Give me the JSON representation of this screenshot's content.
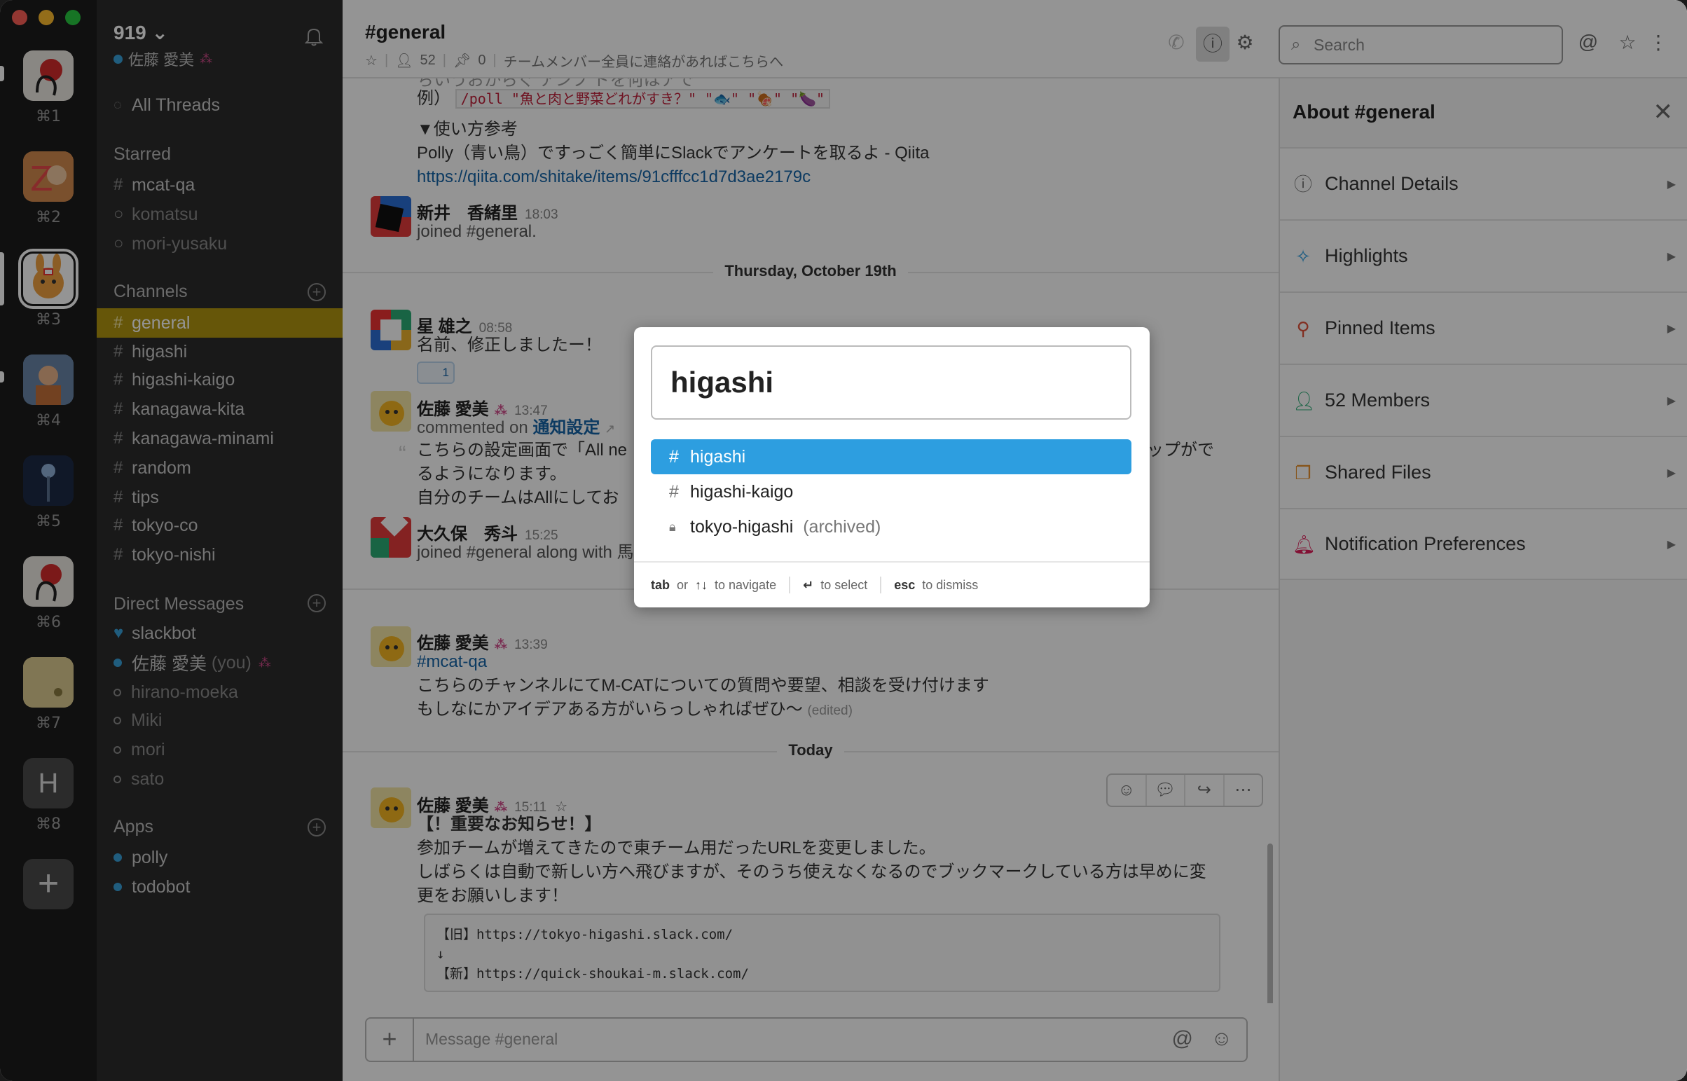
{
  "window": {
    "traffic_colors": [
      "#fe5f57",
      "#febc2e",
      "#28c840"
    ]
  },
  "teams": [
    {
      "key": "⌘1",
      "color": "#e8e4e0"
    },
    {
      "key": "⌘2",
      "color": "#d88a4a"
    },
    {
      "key": "⌘3",
      "color": "#ffffff"
    },
    {
      "key": "⌘4",
      "color": "#5a7aa0"
    },
    {
      "key": "⌘5",
      "color": "#1e2a44"
    },
    {
      "key": "⌘6",
      "color": "#e8e4e0"
    },
    {
      "key": "⌘7",
      "color": "#d8c790"
    },
    {
      "key": "⌘8",
      "letter": "H",
      "color": "#4a4a4a"
    }
  ],
  "sidebar": {
    "workspace": "919 ⌄",
    "user": "佐藤 愛美",
    "all_threads": "All Threads",
    "starred_head": "Starred",
    "starred": [
      {
        "pre": "#",
        "name": "mcat-qa"
      },
      {
        "pre": "○",
        "name": "komatsu"
      },
      {
        "pre": "○",
        "name": "mori-yusaku"
      }
    ],
    "channels_head": "Channels",
    "channels": [
      "general",
      "higashi",
      "higashi-kaigo",
      "kanagawa-kita",
      "kanagawa-minami",
      "random",
      "tips",
      "tokyo-co",
      "tokyo-nishi"
    ],
    "dm_head": "Direct Messages",
    "dms": [
      {
        "name": "slackbot",
        "status": "heart"
      },
      {
        "name": "佐藤 愛美",
        "suffix": "(you)",
        "status": "online"
      },
      {
        "name": "hirano-moeka",
        "status": "away"
      },
      {
        "name": "Miki",
        "status": "away"
      },
      {
        "name": "mori",
        "status": "away"
      },
      {
        "name": "sato",
        "status": "away"
      }
    ],
    "apps_head": "Apps",
    "apps": [
      "polly",
      "todobot"
    ]
  },
  "header": {
    "channel": "#general",
    "members": "52",
    "pins": "0",
    "topic": "チームメンバー全員に連絡があればこちらへ",
    "search_placeholder": "Search"
  },
  "messages": {
    "partial_top": "ちいうおからぐ アンプ ドを何はアで",
    "poll_prefix": "例）",
    "poll_code": "/poll \"魚と肉と野菜どれがすき？\" \"🐟\" \"🍖\" \"🍆\"",
    "howto": "▼使い方参考",
    "polly_line": "Polly（青い鳥）ですっごく簡単にSlackでアンケートを取るよ - Qiita",
    "qiita_url": "https://qiita.com/shitake/items/91cfffcc1d7d3ae2179c",
    "m1_name": "新井　香緒里",
    "m1_time": "18:03",
    "m1_text": "joined #general.",
    "day1": "Thursday, October 19th",
    "m2_name": "星 雄之",
    "m2_time": "08:58",
    "m2_text": "名前、修正しましたー！",
    "m2_reaction": "1",
    "m3_name": "佐藤 愛美",
    "m3_time": "13:47",
    "m3_commented": "commented on",
    "m3_link": "通知設定",
    "m3_quote1": "こちらの設定画面で「All ne",
    "m3_quote1_tail": "ップがで",
    "m3_quote2": "るようになります。",
    "m3_quote3": "自分のチームはAllにしてお",
    "m4_name": "大久保　秀斗",
    "m4_time": "15:25",
    "m4_text": "joined #general along with 馬",
    "m5_name": "佐藤 愛美",
    "m5_time": "13:39",
    "m5_channel": "#mcat-qa",
    "m5_line1": "こちらのチャンネルにてM-CATについての質問や要望、相談を受け付けます",
    "m5_line2": "もしなにかアイデアある方がいらっしゃればぜひ〜",
    "m5_edited": "(edited)",
    "day2": "Today",
    "m6_name": "佐藤 愛美",
    "m6_time": "15:11",
    "m6_line1": "【！重要なお知らせ！】",
    "m6_line2": "参加チームが増えてきたので東チーム用だったURLを変更しました。",
    "m6_line3": "しばらくは自動で新しい方へ飛びますが、そのうち使えなくなるのでブックマークしている方は早めに変",
    "m6_line4": "更をお願いします！",
    "pre_line1": "【旧】https://tokyo-higashi.slack.com/",
    "pre_line2": "↓",
    "pre_line3": "【新】https://quick-shoukai-m.slack.com/"
  },
  "composer": {
    "placeholder": "Message #general"
  },
  "right_panel": {
    "title": "About #general",
    "rows": [
      {
        "label": "Channel Details",
        "icon": "info-icon",
        "color": "#777"
      },
      {
        "label": "Highlights",
        "icon": "sparkle-icon",
        "color": "#2d9ee0"
      },
      {
        "label": "Pinned Items",
        "icon": "pin-icon",
        "color": "#e0513a"
      },
      {
        "label": "52 Members",
        "icon": "person-icon",
        "color": "#2bac76"
      },
      {
        "label": "Shared Files",
        "icon": "files-icon",
        "color": "#e8912d"
      },
      {
        "label": "Notification Preferences",
        "icon": "bell-icon",
        "color": "#e01e5a"
      }
    ]
  },
  "switcher": {
    "query": "higashi",
    "results": [
      {
        "pre": "#",
        "name": "higashi",
        "selected": true
      },
      {
        "pre": "#",
        "name": "higashi-kaigo"
      },
      {
        "pre": "🔒",
        "name": "tokyo-higashi",
        "note": "(archived)"
      }
    ],
    "hint_tab": "tab",
    "hint_or": "or",
    "hint_arrows": "↑↓",
    "hint_nav": "to navigate",
    "hint_enter": "↵",
    "hint_select": "to select",
    "hint_esc": "esc",
    "hint_dismiss": "to dismiss"
  }
}
